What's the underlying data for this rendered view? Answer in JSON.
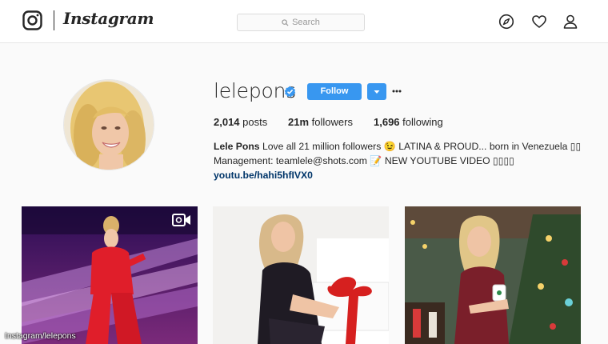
{
  "nav": {
    "logo_text": "Instagram",
    "search_placeholder": "Search",
    "icons": [
      "instagram-glyph-icon",
      "search-icon",
      "compass-icon",
      "heart-icon",
      "person-icon"
    ]
  },
  "profile": {
    "username": "lelepons",
    "verified": true,
    "follow_label": "Follow",
    "stats": [
      {
        "value": "2,014",
        "label": "posts"
      },
      {
        "value": "21m",
        "label": "followers"
      },
      {
        "value": "1,696",
        "label": "following"
      }
    ],
    "full_name": "Lele Pons",
    "bio_line1_rest": "Love all 21 million followers 😉 LATINA & PROUD... born in Venezuela ▯▯",
    "bio_line2": "Management: teamlele@shots.com 📝 NEW YOUTUBE VIDEO ▯▯▯▯",
    "website": "youtu.be/hahi5hfIVX0"
  },
  "posts": [
    {
      "type": "video"
    },
    {
      "type": "photo"
    },
    {
      "type": "photo"
    }
  ],
  "credit": "Instagram/lelepons",
  "colors": {
    "accent_blue": "#3897f0",
    "link_blue": "#003569",
    "text": "#262626",
    "background": "#fafafa"
  }
}
